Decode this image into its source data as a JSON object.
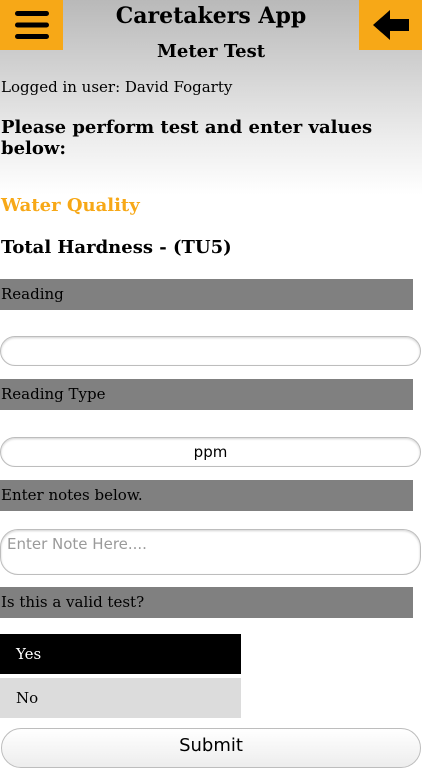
{
  "header": {
    "app_title": "Caretakers App",
    "page_title": "Meter Test",
    "menu_icon": "hamburger-menu-icon",
    "back_icon": "arrow-left-icon",
    "accent_color": "#f7a817"
  },
  "user": {
    "logged_in_text": "Logged in user: David Fogarty"
  },
  "instructions": "Please perform test and enter values below:",
  "section": {
    "title": "Water Quality",
    "title_color": "#f7a817"
  },
  "test": {
    "name": "Total Hardness - (TU5)"
  },
  "form": {
    "reading_label": "Reading",
    "reading_value": "",
    "reading_type_label": "Reading Type",
    "reading_type_value": "ppm",
    "notes_label": "Enter notes below.",
    "notes_placeholder": "Enter Note Here....",
    "valid_label": "Is this a valid test?",
    "options": [
      {
        "label": "Yes",
        "selected": true
      },
      {
        "label": "No",
        "selected": false
      }
    ],
    "submit_label": "Submit"
  }
}
